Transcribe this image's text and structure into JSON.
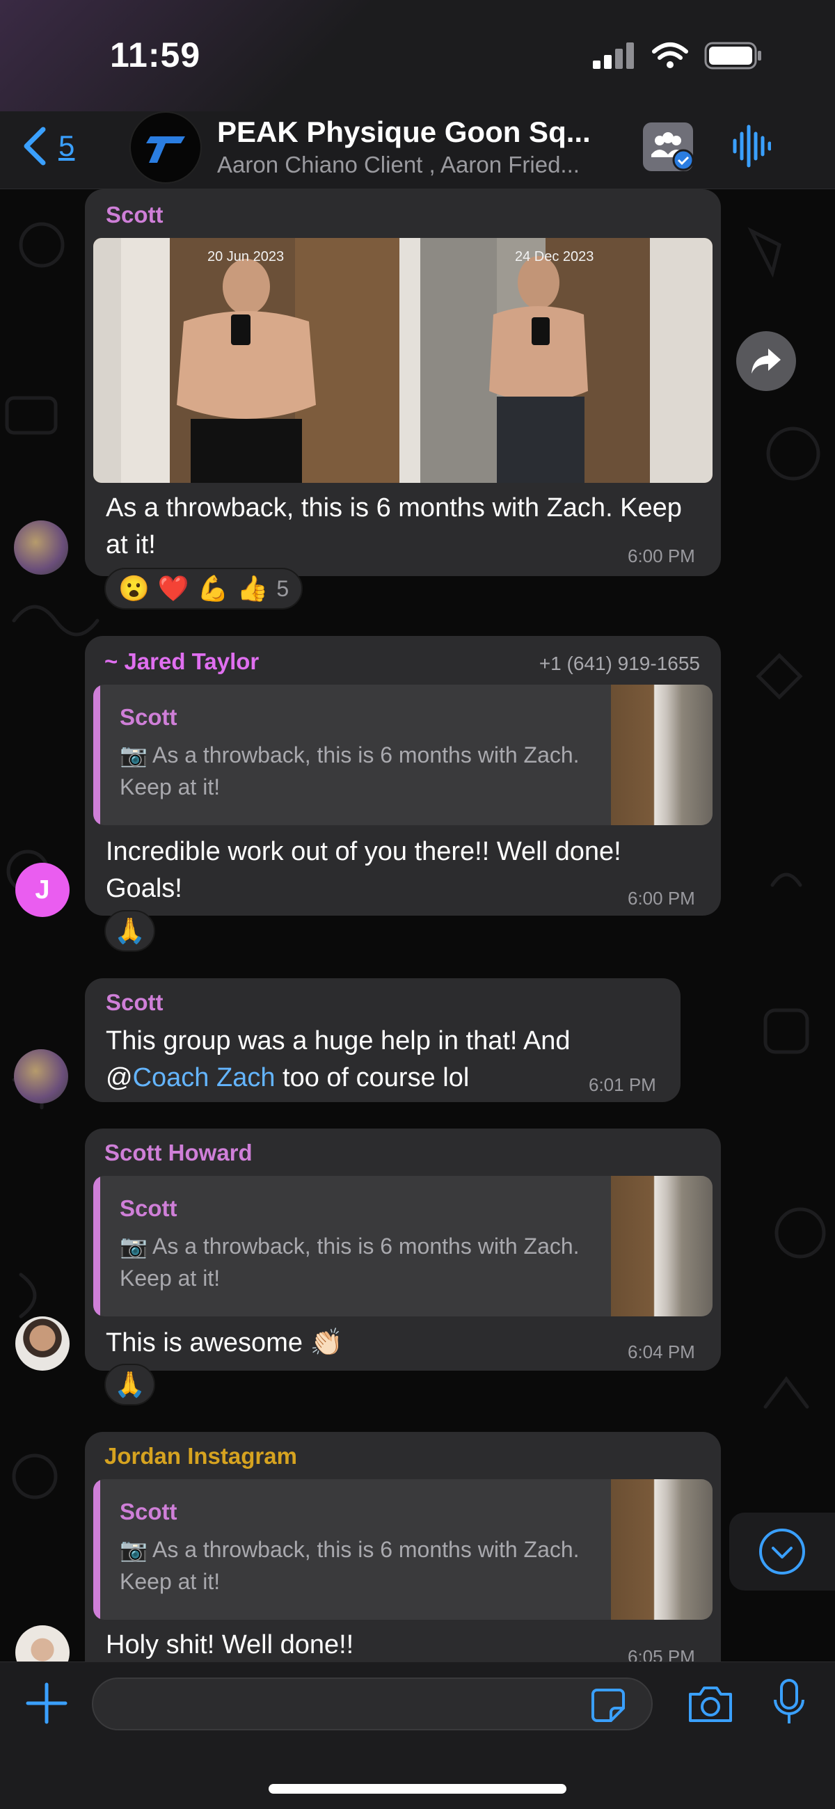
{
  "status_bar": {
    "time": "11:59",
    "icons": [
      "cellular-signal-icon",
      "wifi-icon",
      "battery-icon"
    ]
  },
  "header": {
    "back_count": "5",
    "title": "PEAK Physique Goon Sq...",
    "subtitle": "Aaron Chiano Client , Aaron Fried...",
    "icons": [
      "back-chevron-icon",
      "group-avatar-logo",
      "group-members-icon",
      "voice-chat-icon"
    ]
  },
  "messages": [
    {
      "sender": "Scott",
      "image_dates": [
        "20 Jun 2023",
        "24 Dec 2023"
      ],
      "text": "As a throwback, this is 6 months with Zach. Keep at it!",
      "time": "6:00 PM",
      "reactions": {
        "emojis": [
          "😮",
          "❤️",
          "💪",
          "👍"
        ],
        "count": "5"
      }
    },
    {
      "sender": "~ Jared Taylor",
      "phone": "+1 (641) 919-1655",
      "avatar_initial": "J",
      "quote": {
        "name": "Scott",
        "text": "As a throwback, this is 6 months with Zach. Keep at it!"
      },
      "text": "Incredible work out of you there!! Well done! Goals!",
      "time": "6:00 PM",
      "reaction": "🙏"
    },
    {
      "sender": "Scott",
      "text_before": "This group was a huge help in that! And",
      "mention_at": "@",
      "mention": "Coach Zach",
      "text_after": " too of course lol",
      "time": "6:01 PM"
    },
    {
      "sender": "Scott Howard",
      "quote": {
        "name": "Scott",
        "text": "As a throwback, this is 6 months with Zach. Keep at it!"
      },
      "text": "This is awesome 👏🏻",
      "time": "6:04 PM",
      "reaction": "🙏"
    },
    {
      "sender": "Jordan Instagram",
      "quote": {
        "name": "Scott",
        "text": "As a throwback, this is 6 months with Zach. Keep at it!"
      },
      "text": "Holy shit!  Well done!!",
      "time": "6:05 PM"
    }
  ],
  "composer": {
    "placeholder": ""
  },
  "colors": {
    "accent": "#3aa0ff",
    "bubble": "#2c2c2e",
    "scott": "#cf7fd8",
    "jared": "#e06ff0",
    "scott_howard": "#cf7fd8",
    "jordan": "#d6a320",
    "mention": "#64b5ff"
  }
}
